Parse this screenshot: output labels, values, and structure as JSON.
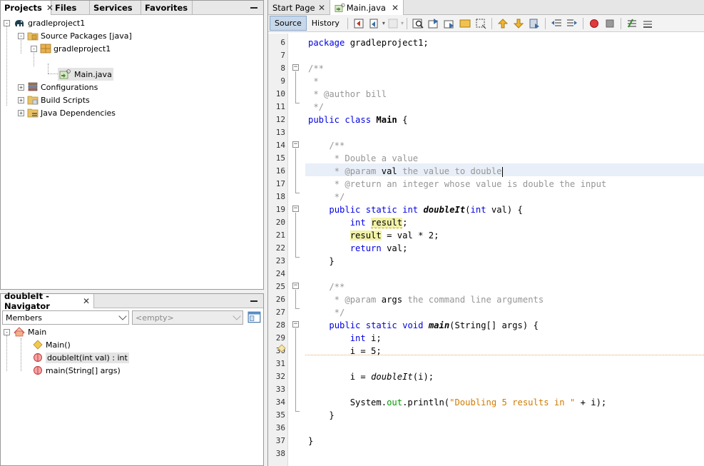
{
  "projects_panel": {
    "tabs": [
      {
        "label": "Projects",
        "active": true,
        "closable": true
      },
      {
        "label": "Files",
        "active": false
      },
      {
        "label": "Services",
        "active": false
      },
      {
        "label": "Favorites",
        "active": false
      }
    ],
    "tree": [
      {
        "label": "gradleproject1",
        "toggle": "-",
        "icon": "gradle-elephant-icon"
      },
      {
        "label": "Source Packages [java]",
        "toggle": "-",
        "icon": "source-packages-icon"
      },
      {
        "label": "gradleproject1",
        "toggle": "-",
        "icon": "package-icon"
      },
      {
        "label": "Main.java",
        "toggle": "",
        "icon": "java-file-icon"
      },
      {
        "label": "Configurations",
        "toggle": "+",
        "icon": "configurations-icon"
      },
      {
        "label": "Build Scripts",
        "toggle": "+",
        "icon": "folder-icon"
      },
      {
        "label": "Java Dependencies",
        "toggle": "+",
        "icon": "library-folder-icon"
      }
    ]
  },
  "navigator_panel": {
    "title": "doubleIt - Navigator",
    "filter_select": "Members",
    "scope_select": "<empty>",
    "tree": [
      {
        "label": "Main",
        "toggle": "-",
        "icon": "class-icon"
      },
      {
        "label": "Main()",
        "icon": "constructor-icon"
      },
      {
        "label": "doubleIt(int val) : int",
        "icon": "method-icon",
        "selected": true
      },
      {
        "label": "main(String[] args)",
        "icon": "method-icon"
      }
    ]
  },
  "editor": {
    "tabs": [
      {
        "label": "Start Page",
        "active": false
      },
      {
        "label": "Main.java",
        "active": true
      }
    ],
    "toolbar": {
      "source_label": "Source",
      "history_label": "History"
    },
    "current_line": 16,
    "line_numbers": [
      "6",
      "7",
      "8",
      "9",
      "10",
      "11",
      "12",
      "13",
      "14",
      "15",
      "16",
      "17",
      "18",
      "19",
      "20",
      "21",
      "22",
      "23",
      "24",
      "25",
      "26",
      "27",
      "28",
      "29",
      "30",
      "31",
      "32",
      "33",
      "34",
      "35",
      "36",
      "37",
      "38"
    ],
    "code_lines": [
      "package gradleproject1;",
      "",
      "/**",
      " *",
      " * @author bill",
      " */",
      "public class Main {",
      "",
      "    /**",
      "     * Double a value",
      "     * @param val the value to double",
      "     * @return an integer whose value is double the input",
      "     */",
      "    public static int doubleIt(int val) {",
      "        int result;",
      "        result = val * 2;",
      "        return val;",
      "    }",
      "",
      "    /**",
      "     * @param args the command line arguments",
      "     */",
      "    public static void main(String[] args) {",
      "        int i;",
      "        i = 5;",
      "",
      "        i = doubleIt(i);",
      "",
      "        System.out.println(\"Doubling 5 results in \" + i);",
      "    }",
      "",
      "}",
      ""
    ]
  },
  "colors": {
    "keyword": "#0000e6",
    "comment": "#969696",
    "string": "#ce7b00",
    "field": "#009900",
    "highlight": "#f2f2a8",
    "current_line": "#e9eff8"
  }
}
